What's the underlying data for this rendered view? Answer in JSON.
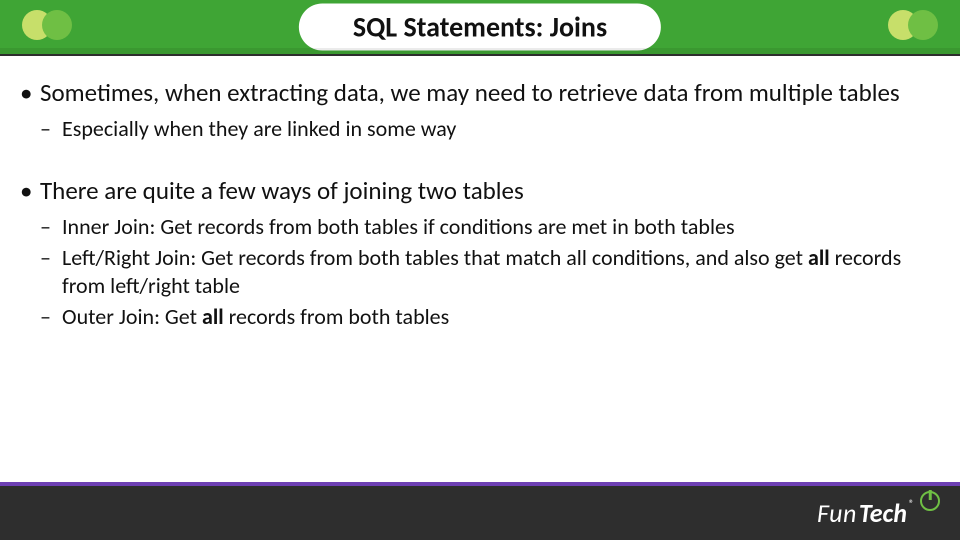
{
  "title": "SQL Statements: Joins",
  "bullets": [
    {
      "text": "Sometimes, when extracting data, we may need to retrieve data from multiple tables",
      "sub": [
        {
          "text": "Especially when they are linked in some way"
        }
      ]
    },
    {
      "text": "There are quite a few ways of joining two tables",
      "sub": [
        {
          "prefix": "Inner Join: Get records from both tables if conditions are met in both tables"
        },
        {
          "prefix": "Left/Right Join: Get records from both tables that match all conditions, and also get ",
          "bold": "all",
          "suffix": " records from left/right table"
        },
        {
          "prefix": "Outer Join: Get ",
          "bold": "all",
          "suffix": " records from both tables"
        }
      ]
    }
  ],
  "logo": {
    "part1": "Fun",
    "part2": "Tech",
    "reg": "®"
  }
}
